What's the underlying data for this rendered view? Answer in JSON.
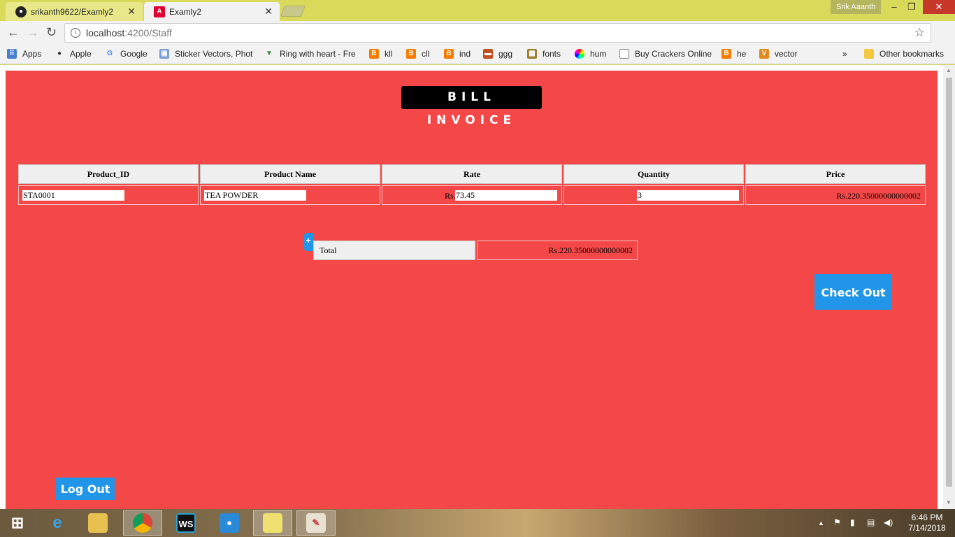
{
  "browser": {
    "tabs": [
      {
        "label": "srikanth9622/Examly2",
        "icon": "github-icon"
      },
      {
        "label": "Examly2",
        "icon": "angular-icon"
      }
    ],
    "profile": "Srik Aaanth",
    "url_host": "localhost",
    "url_path": ":4200/Staff",
    "bookmarks": [
      {
        "label": "Apps",
        "icon": "apps-grid-icon"
      },
      {
        "label": "Apple",
        "icon": "apple-icon"
      },
      {
        "label": "Google",
        "icon": "google-icon"
      },
      {
        "label": "Sticker Vectors, Phot",
        "icon": "picture-icon"
      },
      {
        "label": "Ring with heart - Fre",
        "icon": "vector-icon"
      },
      {
        "label": "kll",
        "icon": "blogger-icon"
      },
      {
        "label": "cll",
        "icon": "blogger-icon"
      },
      {
        "label": "ind",
        "icon": "blogger-icon"
      },
      {
        "label": "ggg",
        "icon": "image-icon"
      },
      {
        "label": "fonts",
        "icon": "font-icon"
      },
      {
        "label": "hum",
        "icon": "color-wheel-icon"
      },
      {
        "label": "Buy Crackers Online",
        "icon": "page-icon"
      },
      {
        "label": "he",
        "icon": "blogger-icon"
      },
      {
        "label": "vector",
        "icon": "v-icon"
      }
    ],
    "other_bookmarks": "Other bookmarks",
    "more_bookmarks": "»"
  },
  "page": {
    "title": "BILL INVOICE",
    "table": {
      "headers": [
        "Product_ID",
        "Product Name",
        "Rate",
        "Quantity",
        "Price"
      ],
      "rows": [
        {
          "product_id": "STA0001",
          "product_name": "TEA POWDER",
          "rate_prefix": "Rs.",
          "rate": "73.45",
          "quantity": "3",
          "price": "Rs.220.35000000000002"
        }
      ]
    },
    "add_label": "+",
    "total_label": "Total",
    "total_value": "Rs.220.35000000000002",
    "checkout_label": "Check Out",
    "logout_label": "Log Out"
  },
  "taskbar": {
    "time": "6:46 PM",
    "date": "7/14/2018"
  },
  "colors": {
    "page_bg": "#f44848",
    "button_blue": "#2196e8",
    "chrome_yellow": "#d9d95a"
  }
}
